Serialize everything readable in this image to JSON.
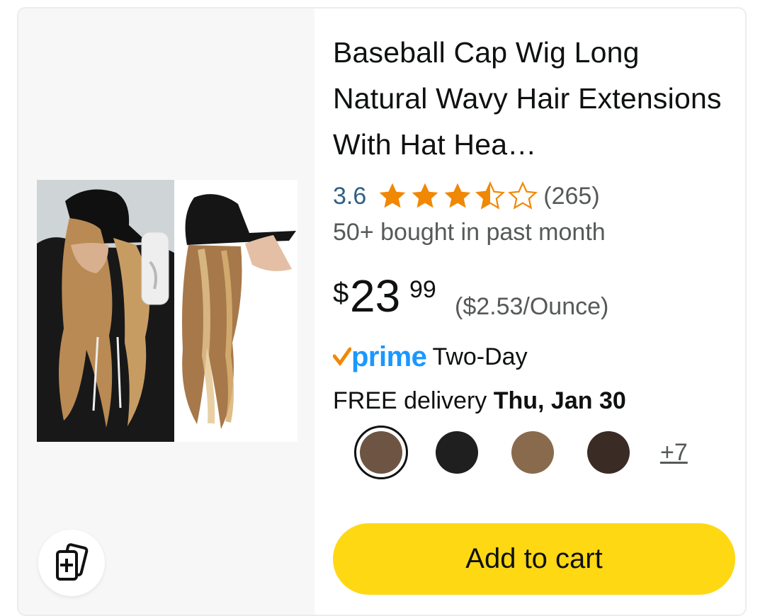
{
  "product": {
    "title": "Baseball Cap Wig Long Natural Wavy Hair Extensions With Hat Hea…",
    "rating": "3.6",
    "rating_value": 3.6,
    "review_count": "(265)",
    "bought": "50+ bought in past month",
    "price_symbol": "$",
    "price_whole": "23",
    "price_fraction": "99",
    "unit_price": "($2.53/Ounce)",
    "prime_brand": "prime",
    "prime_label": "Two-Day",
    "delivery_prefix": "FREE delivery ",
    "delivery_date": "Thu, Jan 30",
    "swatches": [
      {
        "color": "#6e5543",
        "selected": true
      },
      {
        "color": "#1f1f1f",
        "selected": false
      },
      {
        "color": "#8a6a4d",
        "selected": false
      },
      {
        "color": "#3a2b24",
        "selected": false
      }
    ],
    "more_colors": "+7",
    "add_to_cart": "Add to cart"
  },
  "icons": {
    "compare": "compare-cards-icon",
    "star": "star-icon",
    "prime": "prime-check-icon"
  },
  "colors": {
    "accent_button": "#ffd814",
    "star": "#f08804",
    "rating_link": "#2f5f86",
    "prime": "#1a98ff"
  }
}
